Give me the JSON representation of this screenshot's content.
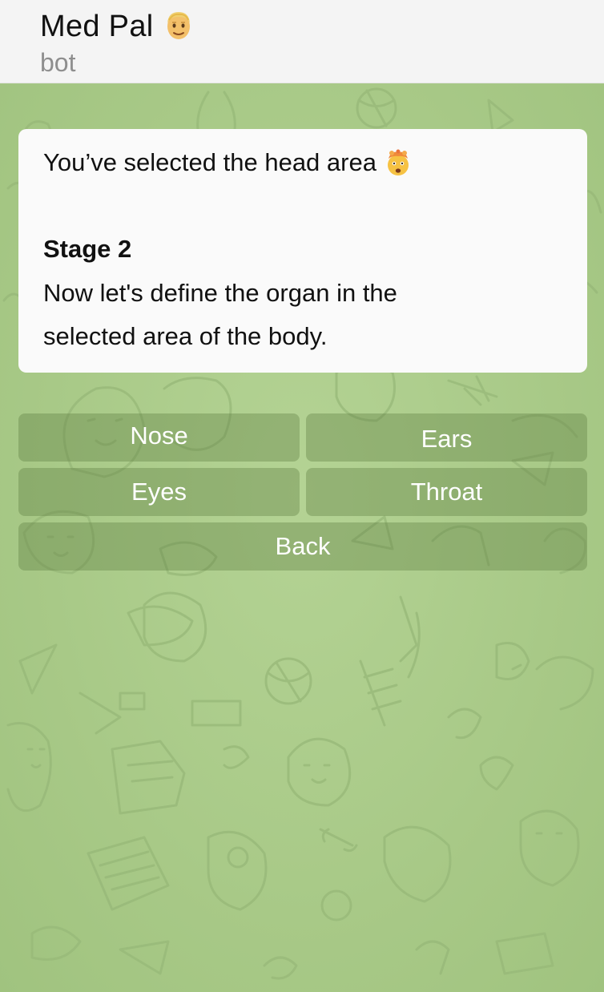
{
  "header": {
    "title": "Med Pal",
    "title_icon": "man-face-emoji-icon",
    "subtitle": "bot"
  },
  "message": {
    "line1": "You’ve selected the head area",
    "line1_icon": "exploding-head-emoji-icon",
    "stage": "Stage 2",
    "body_line1": "Now let's define the organ in the",
    "body_line2": "selected area of the body."
  },
  "keyboard": {
    "nose": "Nose",
    "ears": "Ears",
    "eyes": "Eyes",
    "throat": "Throat",
    "back": "Back"
  },
  "colors": {
    "chat_background": "#a9c98a",
    "header_background": "#f4f4f4",
    "bubble_background": "#fafafa"
  }
}
